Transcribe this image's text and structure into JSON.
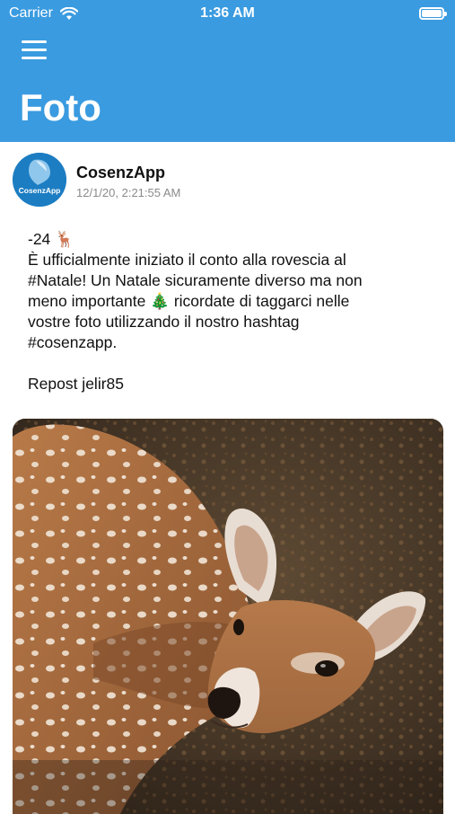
{
  "status_bar": {
    "carrier": "Carrier",
    "time": "1:36 AM",
    "icons": [
      "wifi-icon",
      "battery-icon"
    ]
  },
  "header": {
    "title": "Foto",
    "menu_icon": "hamburger-menu-icon",
    "background_color": "#3a9be0"
  },
  "post": {
    "author": "CosenzApp",
    "avatar_text": "CosenzApp",
    "timestamp": "12/1/20, 2:21:55 AM",
    "text_lines": [
      "-24 🦌",
      "È ufficialmente iniziato il conto alla rovescia al",
      "#Natale! Un Natale sicuramente diverso ma non",
      "meno importante 🎄 ricordate di taggarci nelle",
      "vostre foto utilizzando il nostro hashtag",
      "#cosenzapp.",
      "",
      "Repost jelir85"
    ],
    "image_subject": "fawn-deer-photo"
  }
}
